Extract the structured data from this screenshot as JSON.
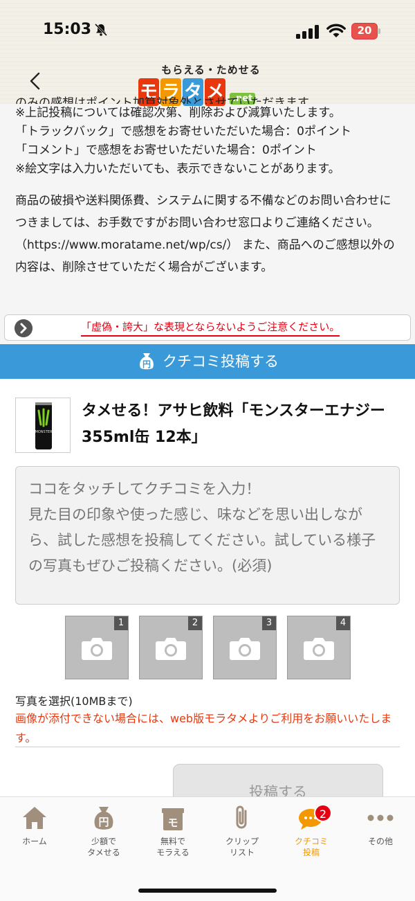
{
  "status": {
    "time": "15:03",
    "battery": "20"
  },
  "header": {
    "logo_tagline": "もらえる・ためせる",
    "logo_chars": [
      "モ",
      "ラ",
      "タ",
      "メ"
    ],
    "logo_colors": [
      "#e8380d",
      "#f39800",
      "#3a9ad9",
      "#e8380d"
    ],
    "logo_net": ".net"
  },
  "notes": {
    "cut_line": "のみの感想はポイント加算対象外とさせていただきます。",
    "lines": [
      "※上記投稿については確認次第、削除および減算いたします。",
      "「トラックバック」で感想をお寄せいただいた場合：0ポイント",
      "「コメント」で感想をお寄せいただいた場合：0ポイント",
      "※絵文字は入力いただいても、表示できないことがあります。"
    ],
    "paragraph": "商品の破損や送料関係費、システムに関する不備などのお問い合わせにつきましては、お手数ですがお問い合わせ窓口よりご連絡ください。 （https://www.moratame.net/wp/cs/） また、商品へのご感想以外の内容は、削除させていただく場合がございます。"
  },
  "warning_bar": {
    "text": "「虚偽・誇大」な表現とならないようご注意ください。"
  },
  "post_bar": {
    "label": "クチコミ投稿する"
  },
  "product": {
    "title": "タメせる！アサヒ飲料「モンスターエナジー 355ml缶 12本」",
    "can_label": "MONSTER"
  },
  "review": {
    "placeholder": "ココをタッチしてクチコミを入力！\n見た目の印象や使った感じ、味などを思い出しながら、試した感想を投稿してください。試している様子の写真もぜひご投稿ください。(必須)"
  },
  "photos": {
    "slots": [
      "1",
      "2",
      "3",
      "4"
    ],
    "note": "写真を選択(10MBまで)",
    "warning": "画像が添付できない場合には、web版モラタメよりご利用をお願いいたします。"
  },
  "submit": {
    "label": "投稿する"
  },
  "tabbar": {
    "accent": "#f39800",
    "items": [
      {
        "label": "ホーム",
        "icon": "home-icon"
      },
      {
        "label": "少額で\nタメせる",
        "icon": "money-bag-icon"
      },
      {
        "label": "無料で\nモラえる",
        "icon": "gift-icon"
      },
      {
        "label": "クリップ\nリスト",
        "icon": "paperclip-icon"
      },
      {
        "label": "クチコミ\n投稿",
        "icon": "chat-bubble-icon",
        "badge": "2"
      },
      {
        "label": "その他",
        "icon": "more-icon"
      }
    ]
  }
}
